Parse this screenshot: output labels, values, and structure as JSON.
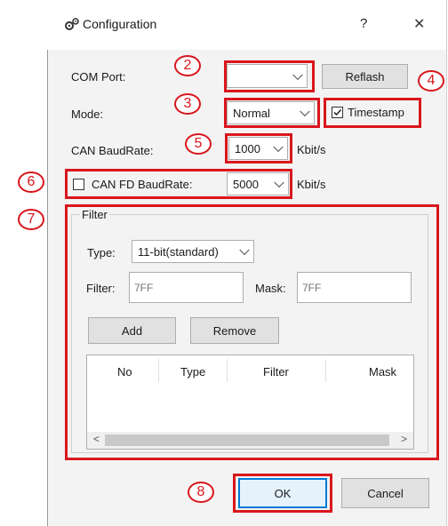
{
  "dialog": {
    "title": "Configuration",
    "help_glyph": "?",
    "close_glyph": "✕",
    "icon": "gears-icon"
  },
  "form": {
    "com_port": {
      "label": "COM Port:",
      "value": "",
      "reflash_label": "Reflash"
    },
    "mode": {
      "label": "Mode:",
      "value": "Normal",
      "timestamp_label": "Timestamp",
      "timestamp_checked": true
    },
    "can_baud": {
      "label": "CAN BaudRate:",
      "value": "1000",
      "unit": "Kbit/s"
    },
    "canfd_baud": {
      "label": "CAN FD BaudRate:",
      "value": "5000",
      "unit": "Kbit/s",
      "checked": false
    }
  },
  "filter": {
    "group_title": "Filter",
    "type_label": "Type:",
    "type_value": "11-bit(standard)",
    "filter_label": "Filter:",
    "filter_placeholder": "7FF",
    "mask_label": "Mask:",
    "mask_placeholder": "7FF",
    "add_label": "Add",
    "remove_label": "Remove",
    "columns": [
      "No",
      "Type",
      "Filter",
      "Mask"
    ],
    "scroll_left": "<",
    "scroll_right": ">"
  },
  "footer": {
    "ok_label": "OK",
    "cancel_label": "Cancel"
  },
  "annotations": [
    "2",
    "3",
    "4",
    "5",
    "6",
    "7",
    "8"
  ],
  "colors": {
    "annotation": "#d9161c",
    "ok_focus": "#0078d7"
  }
}
